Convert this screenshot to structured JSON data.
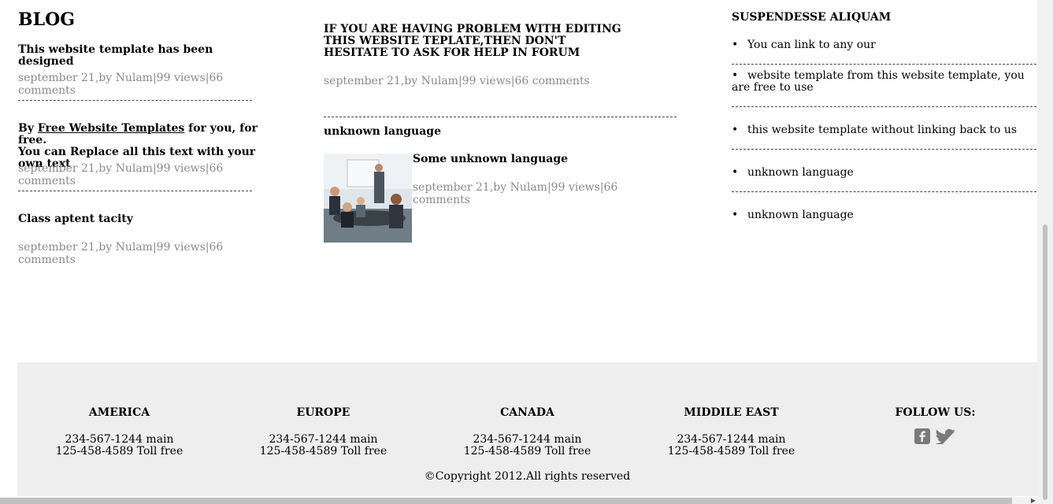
{
  "blog": {
    "title": "BLOG",
    "posts": [
      {
        "title": "This website template has been designed",
        "meta": "september 21,by Nulam|99 views|66 comments"
      },
      {
        "title_prefix": "By ",
        "link": "Free Website Templates",
        "title_suffix": " for you, for free.",
        "title_line2": "You can Replace all this text with your own text",
        "meta": "september 21,by Nulam|99 views|66 comments"
      },
      {
        "title": "Class aptent tacity",
        "meta": "september 21,by Nulam|99 views|66 comments"
      }
    ]
  },
  "middle": {
    "headline": "IF YOU ARE HAVING PROBLEM WITH EDITING THIS WEBSITE TEPLATE,THEN DON'T HESITATE TO ASK FOR HELP IN FORUM",
    "headline_meta": "september 21,by Nulam|99 views|66 comments",
    "section_title": "unknown language",
    "post_title": "Some unknown language",
    "post_meta": "september 21,by Nulam|99 views|66 comments"
  },
  "sidebar": {
    "title": "SUSPENDESSE ALIQUAM",
    "items": [
      "You can link to any our",
      "website template from this website template, you are free to use",
      "this website template without linking back to us",
      "unknown language",
      "unknown language"
    ]
  },
  "footer": {
    "regions": [
      {
        "name": "AMERICA",
        "main": "234-567-1244 main",
        "toll": "125-458-4589 Toll free"
      },
      {
        "name": "EUROPE",
        "main": "234-567-1244 main",
        "toll": "125-458-4589 Toll free"
      },
      {
        "name": "CANADA",
        "main": "234-567-1244 main",
        "toll": "125-458-4589 Toll free"
      },
      {
        "name": "MIDDILE EAST",
        "main": "234-567-1244 main",
        "toll": "125-458-4589 Toll free"
      }
    ],
    "follow_title": "FOLLOW US:",
    "social_icons": [
      "facebook-icon",
      "twitter-icon"
    ],
    "copyright": "©Copyright 2012.All rights reserved"
  },
  "colors": {
    "meta_text": "#8a8a8a",
    "footer_bg": "#eeeeee",
    "social_icon": "#7a7a7a"
  }
}
